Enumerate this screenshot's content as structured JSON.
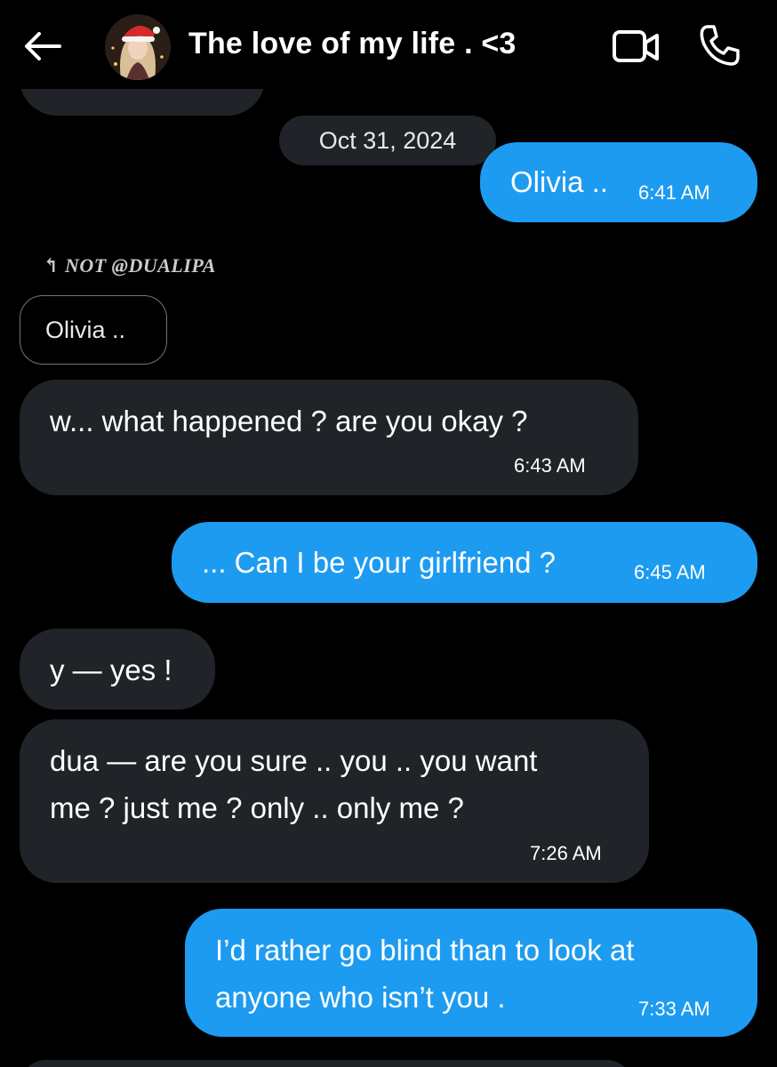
{
  "header": {
    "title": "The love of my life . <3"
  },
  "date_separator": "Oct 31, 2024",
  "reply": {
    "label": "NOT @DUALIPA",
    "quoted_text": "Olivia .."
  },
  "messages": [
    {
      "text": "Olivia ..",
      "time": "6:41 AM",
      "direction": "sent"
    },
    {
      "text": "w... what happened ? are you okay ?",
      "time": "6:43 AM",
      "direction": "received"
    },
    {
      "text": "... Can I be your girlfriend ?",
      "time": "6:45 AM",
      "direction": "sent"
    },
    {
      "text": "y — yes !",
      "time": "",
      "direction": "received"
    },
    {
      "line1": "dua — are you sure .. you .. you want",
      "line2": "me ? just me ? only .. only me ?",
      "time": "7:26 AM",
      "direction": "received"
    },
    {
      "line1": "I’d rather go blind than to look at",
      "line2": "anyone who isn’t you .",
      "time": "7:33 AM",
      "direction": "sent"
    }
  ],
  "colors": {
    "background": "#000000",
    "sent_bubble": "#1d9bf0",
    "received_bubble": "#202327"
  }
}
